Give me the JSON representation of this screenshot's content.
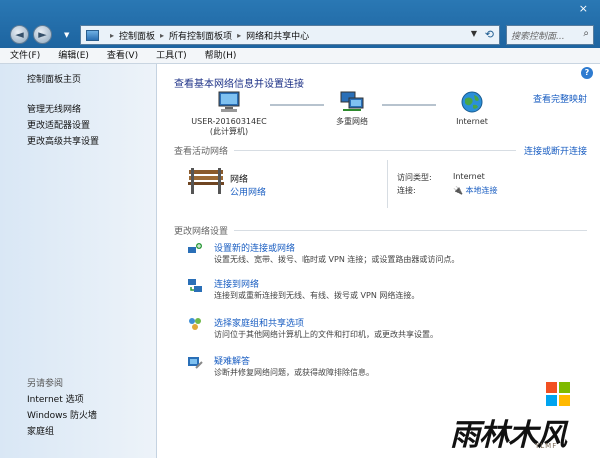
{
  "window": {
    "close_glyph": "×"
  },
  "address": {
    "crumbs": [
      "控制面板",
      "所有控制面板项",
      "网络和共享中心"
    ],
    "separator": "▸",
    "search_placeholder": "搜索控制面..."
  },
  "menu": [
    "文件(F)",
    "编辑(E)",
    "查看(V)",
    "工具(T)",
    "帮助(H)"
  ],
  "sidebar": {
    "home": "控制面板主页",
    "tasks": [
      "管理无线网络",
      "更改适配器设置",
      "更改高级共享设置"
    ],
    "see_also_header": "另请参阅",
    "see_also": [
      "Internet 选项",
      "Windows 防火墙",
      "家庭组"
    ]
  },
  "main": {
    "title": "查看基本网络信息并设置连接",
    "full_map": "查看完整映射",
    "map": {
      "computer_name": "USER-20160314EC",
      "computer_sub": "(此计算机)",
      "middle": "多重网络",
      "internet": "Internet"
    },
    "active_header": "查看活动网络",
    "connect_link": "连接或断开连接",
    "network": {
      "name": "网络",
      "type": "公用网络",
      "access_label": "访问类型:",
      "access_value": "Internet",
      "conn_label": "连接:",
      "conn_value": "本地连接"
    },
    "change_header": "更改网络设置",
    "items": [
      {
        "title": "设置新的连接或网络",
        "desc": "设置无线、宽带、拨号、临时或 VPN 连接；或设置路由器或访问点。"
      },
      {
        "title": "连接到网络",
        "desc": "连接到或重新连接到无线、有线、拨号或 VPN 网络连接。"
      },
      {
        "title": "选择家庭组和共享选项",
        "desc": "访问位于其他网络计算机上的文件和打印机，或更改共享设置。"
      },
      {
        "title": "疑难解答",
        "desc": "诊断并修复网络问题，或获得故障排除信息。"
      }
    ]
  },
  "watermark": {
    "text": "雨林木风",
    "sub": "YLMF"
  },
  "colors": {
    "link": "#1a5ec2",
    "title": "#1e3287",
    "chrome": "#1f6aa3"
  }
}
